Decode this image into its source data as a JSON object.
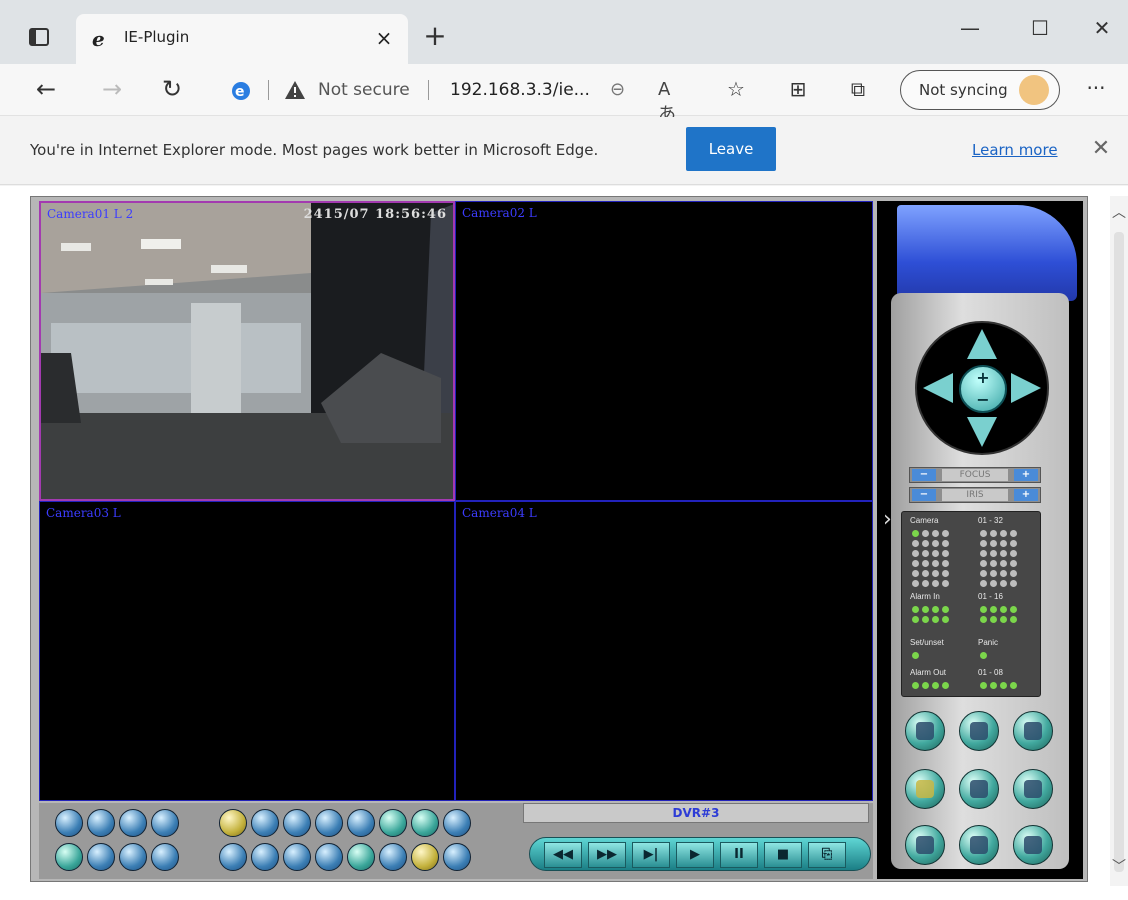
{
  "browser": {
    "tab": {
      "title": "IE-Plugin",
      "close": "×"
    },
    "new_tab": "+",
    "window": {
      "minimize": "—",
      "maximize": "☐",
      "close": "✕"
    },
    "nav": {
      "back": "←",
      "forward": "→",
      "refresh": "↻"
    },
    "address": {
      "security_text": "Not secure",
      "url": "192.168.3.3/ie...",
      "zoom_glyph": "⊖",
      "read_glyph": "Aあ"
    },
    "toolbar_icons": {
      "favorites": "☆",
      "collections": "⊞",
      "share": "⧉"
    },
    "sync": {
      "label": "Not syncing"
    },
    "more": "···"
  },
  "infobar": {
    "message": "You're in Internet Explorer mode. Most pages work better in Microsoft Edge.",
    "leave_label": "Leave",
    "learn_more": "Learn more",
    "close": "✕"
  },
  "viewer": {
    "cameras": [
      {
        "label": "Camera01 L 2",
        "time": "2415/07 18:56:46",
        "active": true
      },
      {
        "label": "Camera02 L",
        "active": false
      },
      {
        "label": "Camera03 L",
        "active": false
      },
      {
        "label": "Camera04 L",
        "active": false
      }
    ],
    "dvr_name": "DVR#3",
    "playback": [
      "◀◀",
      "▶▶",
      "▶|",
      "▶",
      "II",
      "■",
      "⎘"
    ],
    "focus_label": "FOCUS",
    "iris_label": "IRIS",
    "ptz_plus_minus": "+\n−",
    "status": {
      "camera_title": "Camera",
      "camera_range": "01 - 32",
      "alarm_in_title": "Alarm In",
      "alarm_in_range": "01 - 16",
      "setunset_title": "Set/unset",
      "panic_title": "Panic",
      "alarm_out_title": "Alarm Out",
      "alarm_out_range": "01 - 08"
    },
    "colors": {
      "camera_label": "#3c3cff",
      "active_border": "#a33ab0",
      "led_on": "#7bd64b",
      "led_off": "#bdbdbd",
      "leave_button": "#1f74c8"
    }
  }
}
